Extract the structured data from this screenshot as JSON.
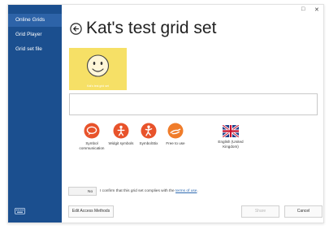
{
  "window": {
    "title": "Kat's test grid set",
    "minimize_glyph": "□",
    "close_glyph": "✕"
  },
  "sidebar": {
    "items": [
      {
        "label": "Online Grids",
        "active": true
      },
      {
        "label": "Grid Player",
        "active": false
      },
      {
        "label": "Grid set file",
        "active": false
      }
    ],
    "footer_icon": "keyboard-icon"
  },
  "gridset": {
    "thumbnail_label": "Kat's test grid set",
    "description": ""
  },
  "badges": [
    {
      "label": "Symbol communication",
      "icon": "speech-bubble-icon",
      "color": "#e8532b"
    },
    {
      "label": "Widgit symbols",
      "icon": "widgit-icon",
      "color": "#e8532b"
    },
    {
      "label": "SymbolStix",
      "icon": "symbolstix-icon",
      "color": "#e8532b"
    },
    {
      "label": "Free to use",
      "icon": "hand-icon",
      "color": "#f07c2a"
    },
    {
      "label": "English (United Kingdom)",
      "icon": "uk-flag-icon",
      "color": "#1e3f8a"
    }
  ],
  "confirm": {
    "toggle_label": "No",
    "text": "I confirm that this grid set complies with the",
    "link": "terms of use",
    "suffix": "."
  },
  "buttons": {
    "edit_access": "Edit Access Methods",
    "share": "Share",
    "cancel": "Cancel"
  }
}
